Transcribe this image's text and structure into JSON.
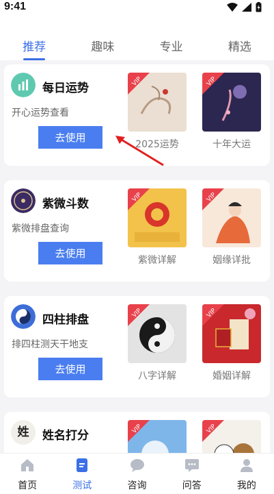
{
  "status": {
    "time": "9:41"
  },
  "tabs": [
    {
      "label": "推荐",
      "active": true
    },
    {
      "label": "趣味",
      "active": false
    },
    {
      "label": "专业",
      "active": false
    },
    {
      "label": "精选",
      "active": false
    }
  ],
  "cards": [
    {
      "title": "每日运势",
      "desc": "开心运势查看",
      "button": "去使用",
      "items": [
        {
          "caption": "2025运势",
          "vip": "VIP"
        },
        {
          "caption": "十年大运",
          "vip": "VIP"
        }
      ]
    },
    {
      "title": "紫微斗数",
      "desc": "紫微排盘查询",
      "button": "去使用",
      "items": [
        {
          "caption": "紫微详解",
          "vip": "VIP"
        },
        {
          "caption": "姻缘详批",
          "vip": "VIP"
        }
      ]
    },
    {
      "title": "四柱排盘",
      "desc": "排四柱测天干地支",
      "button": "去使用",
      "items": [
        {
          "caption": "八字详解",
          "vip": "VIP"
        },
        {
          "caption": "婚姻详解",
          "vip": "VIP"
        }
      ]
    },
    {
      "title": "姓名打分",
      "desc": "",
      "button": "",
      "items": [
        {
          "caption": "",
          "vip": "VIP"
        },
        {
          "caption": "",
          "vip": "VIP"
        }
      ]
    }
  ],
  "card_icons": {
    "c3": "姓"
  },
  "nav": [
    {
      "label": "首页",
      "icon": "home-icon",
      "active": false
    },
    {
      "label": "测试",
      "icon": "test-icon",
      "active": true
    },
    {
      "label": "咨询",
      "icon": "chat-icon",
      "active": false
    },
    {
      "label": "问答",
      "icon": "qa-icon",
      "active": false
    },
    {
      "label": "我的",
      "icon": "profile-icon",
      "active": false
    }
  ],
  "colors": {
    "accent": "#3b6fe6",
    "button": "#4a7ef0",
    "vip": "#e8414b",
    "arrow": "#e02020"
  }
}
